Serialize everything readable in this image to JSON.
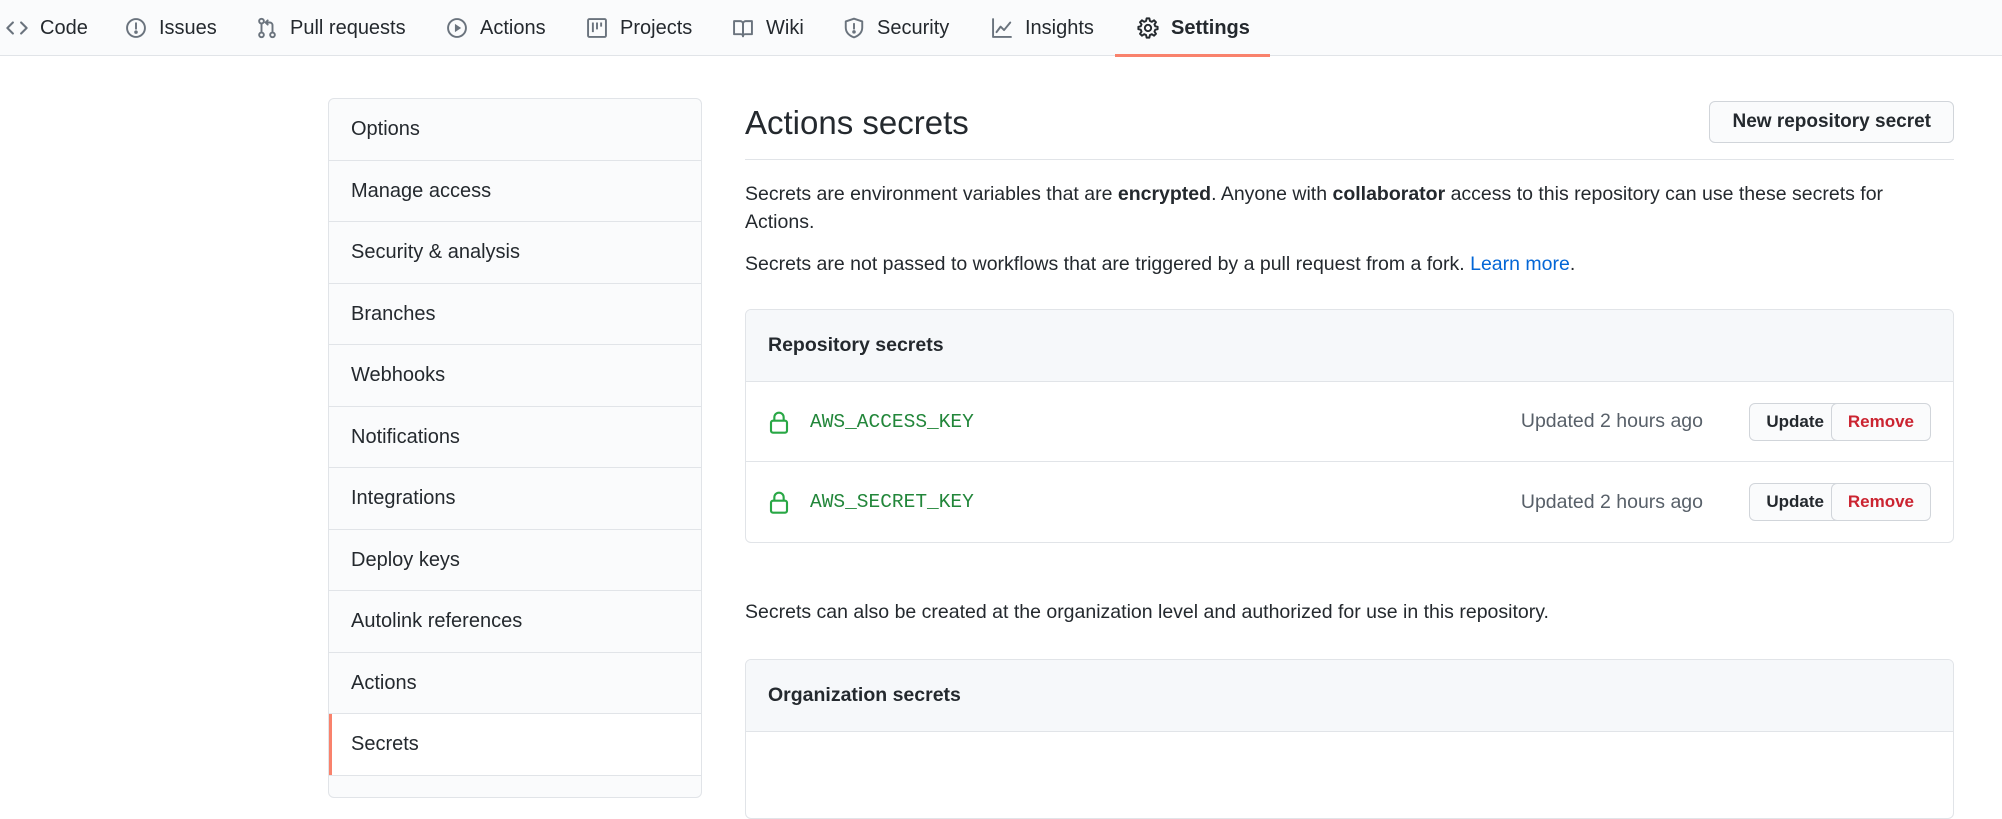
{
  "repo_nav": {
    "tabs": [
      {
        "label": "Code",
        "icon": "code-icon"
      },
      {
        "label": "Issues",
        "icon": "issue-icon"
      },
      {
        "label": "Pull requests",
        "icon": "pull-request-icon"
      },
      {
        "label": "Actions",
        "icon": "play-icon"
      },
      {
        "label": "Projects",
        "icon": "project-icon"
      },
      {
        "label": "Wiki",
        "icon": "book-icon"
      },
      {
        "label": "Security",
        "icon": "shield-icon"
      },
      {
        "label": "Insights",
        "icon": "graph-icon"
      },
      {
        "label": "Settings",
        "icon": "gear-icon",
        "active": true
      }
    ]
  },
  "sidebar": {
    "items": [
      {
        "label": "Options"
      },
      {
        "label": "Manage access"
      },
      {
        "label": "Security & analysis"
      },
      {
        "label": "Branches"
      },
      {
        "label": "Webhooks"
      },
      {
        "label": "Notifications"
      },
      {
        "label": "Integrations"
      },
      {
        "label": "Deploy keys"
      },
      {
        "label": "Autolink references"
      },
      {
        "label": "Actions"
      },
      {
        "label": "Secrets",
        "selected": true
      }
    ]
  },
  "main": {
    "title": "Actions secrets",
    "new_secret_button": "New repository secret",
    "intro": {
      "part1": "Secrets are environment variables that are ",
      "bold1": "encrypted",
      "part2": ". Anyone with ",
      "bold2": "collaborator",
      "part3": " access to this repository can use these secrets for Actions."
    },
    "fork_note": {
      "text": "Secrets are not passed to workflows that are triggered by a pull request from a fork. ",
      "link": "Learn more",
      "end": "."
    },
    "repository_secrets": {
      "header": "Repository secrets",
      "rows": [
        {
          "name": "AWS_ACCESS_KEY",
          "updated": "Updated 2 hours ago",
          "update_label": "Update",
          "remove_label": "Remove"
        },
        {
          "name": "AWS_SECRET_KEY",
          "updated": "Updated 2 hours ago",
          "update_label": "Update",
          "remove_label": "Remove"
        }
      ]
    },
    "org_note": "Secrets can also be created at the organization level and authorized for use in this repository.",
    "organization_secrets": {
      "header": "Organization secrets"
    }
  },
  "colors": {
    "active_tab_underline": "#f9826c",
    "secret_name": "#22863a",
    "lock_icon": "#28a745",
    "remove_text": "#cb2431",
    "link": "#0366d6"
  }
}
